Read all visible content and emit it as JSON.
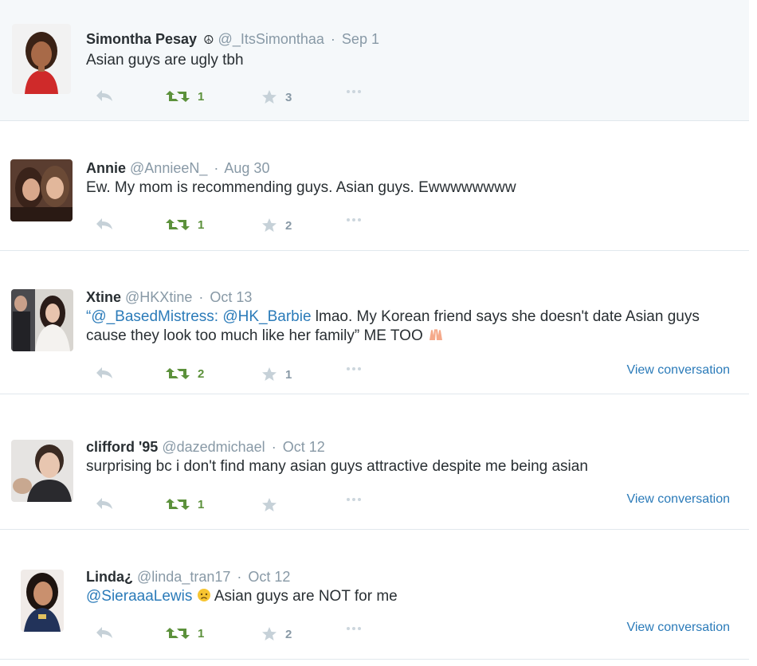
{
  "tweets": [
    {
      "name": "Simontha Pesay",
      "badge": "☮",
      "handle": "@_ItsSimonthaa",
      "sep": "·",
      "time": "Sep 1",
      "text": "Asian guys are ugly tbh",
      "retweets": "1",
      "favorites": "3"
    },
    {
      "name": "Annie",
      "handle": "@AnnieeN_",
      "sep": "·",
      "time": "Aug 30",
      "text": "Ew. My mom is recommending guys. Asian guys. Ewwwwwwww",
      "retweets": "1",
      "favorites": "2"
    },
    {
      "name": "Xtine",
      "handle": "@HKXtine",
      "sep": "·",
      "time": "Oct 13",
      "text_open_quote": "“",
      "mention1": "@_BasedMistress:",
      "mention2": "@HK_Barbie",
      "text_body": " lmao. My Korean friend says she doesn't date Asian guys cause they look too much like her family” ME TOO",
      "retweets": "2",
      "favorites": "1",
      "view_conversation": "View conversation"
    },
    {
      "name": "clifford '95",
      "handle": "@dazedmichael",
      "sep": "·",
      "time": "Oct 12",
      "text": "surprising bc i don't find many asian guys attractive despite me being asian",
      "retweets": "1",
      "favorites": "",
      "view_conversation": "View conversation"
    },
    {
      "name": "Linda¿",
      "handle": "@linda_tran17",
      "sep": "·",
      "time": "Oct 12",
      "mention": "@SieraaaLewis",
      "text_body": "Asian guys are NOT for me",
      "retweets": "1",
      "favorites": "2",
      "view_conversation": "View conversation"
    }
  ],
  "icons": {
    "reply": "reply-icon",
    "retweet": "retweet-icon",
    "favorite": "star-icon",
    "more": "more-icon"
  },
  "colors": {
    "link": "#2b7bb9",
    "retweet": "#5c913b",
    "muted": "#8899a6",
    "highlight_bg": "#f5f8fa"
  }
}
